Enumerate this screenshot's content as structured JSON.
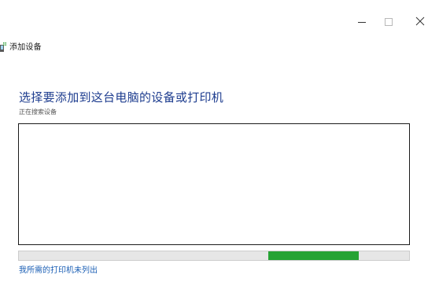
{
  "window": {
    "title": "添加设备",
    "controls": {
      "minimize_icon": "minimize-icon",
      "maximize_icon": "maximize-icon",
      "close_icon": "close-icon"
    }
  },
  "main": {
    "heading": "选择要添加到这台电脑的设备或打印机",
    "status": "正在搜索设备",
    "device_list": {
      "items": []
    },
    "progress": {
      "mode": "indeterminate",
      "color": "#26a334"
    },
    "printer_not_listed_link": "我所需的打印机未列出"
  },
  "colors": {
    "heading": "#1e3d8f",
    "link": "#1b5fb5",
    "progress": "#26a334"
  }
}
